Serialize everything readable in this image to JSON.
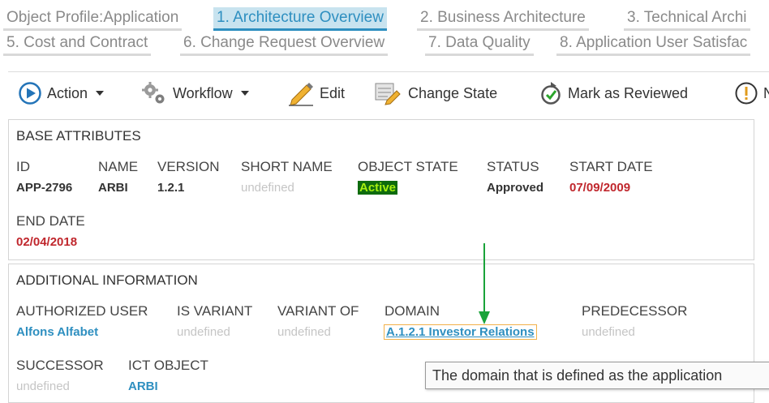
{
  "tabs_row1": [
    {
      "label": "Object Profile:Application",
      "active": false
    },
    {
      "label": "1. Architecture Overview",
      "active": true
    },
    {
      "label": "2. Business Architecture",
      "active": false
    },
    {
      "label": "3. Technical Archi",
      "active": false
    }
  ],
  "tabs_row2": [
    {
      "label": "5. Cost and Contract"
    },
    {
      "label": "6. Change Request Overview"
    },
    {
      "label": "7. Data Quality"
    },
    {
      "label": "8. Application User Satisfac"
    }
  ],
  "toolbar": {
    "action": "Action",
    "workflow": "Workflow",
    "edit": "Edit",
    "change_state": "Change State",
    "mark_reviewed": "Mark as Reviewed",
    "truncated": "N"
  },
  "base": {
    "title": "BASE ATTRIBUTES",
    "id": {
      "label": "ID",
      "value": "APP-2796"
    },
    "name": {
      "label": "NAME",
      "value": "ARBI"
    },
    "version": {
      "label": "VERSION",
      "value": "1.2.1"
    },
    "short_name": {
      "label": "SHORT NAME",
      "value": "undefined"
    },
    "object_state": {
      "label": "OBJECT STATE",
      "value": "Active"
    },
    "status": {
      "label": "STATUS",
      "value": "Approved"
    },
    "start_date": {
      "label": "START DATE",
      "value": "07/09/2009"
    },
    "end_date": {
      "label": "END DATE",
      "value": "02/04/2018"
    }
  },
  "additional": {
    "title": "ADDITIONAL INFORMATION",
    "authorized_user": {
      "label": "AUTHORIZED USER",
      "value": "Alfons Alfabet"
    },
    "is_variant": {
      "label": "IS VARIANT",
      "value": "undefined"
    },
    "variant_of": {
      "label": "VARIANT OF",
      "value": "undefined"
    },
    "domain": {
      "label": "DOMAIN",
      "value": "A.1.2.1 Investor Relations"
    },
    "predecessor": {
      "label": "PREDECESSOR",
      "value": "undefined"
    },
    "successor": {
      "label": "SUCCESSOR",
      "value": "undefined"
    },
    "ict_object": {
      "label": "ICT OBJECT",
      "value": "ARBI"
    }
  },
  "tooltip": "The domain that is defined as the application",
  "colors": {
    "accent": "#2e8fc0",
    "date_red": "#c0272d",
    "active_bg": "#0e6b0e",
    "active_fg": "#a6f010",
    "annotation_arrow": "#1aa33a"
  },
  "icons": {
    "action": "play-circle-icon",
    "workflow": "gears-icon",
    "edit": "pencil-icon",
    "change_state": "change-state-icon",
    "mark_reviewed": "reviewed-icon",
    "truncated": "info-icon"
  }
}
